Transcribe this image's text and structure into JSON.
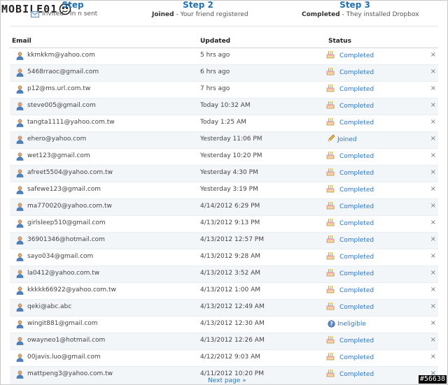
{
  "logo": {
    "text": "MOBILE01"
  },
  "steps": [
    {
      "title": "Step 1",
      "title_visible": "Step",
      "icon": "envelope-icon",
      "strong": "",
      "text": "Invited - Invitation sent",
      "text_visible": "Invited - In        n sent"
    },
    {
      "title": "Step 2",
      "icon": "pencil-icon",
      "strong": "Joined",
      "text": " - Your friend registered"
    },
    {
      "title": "Step 3",
      "icon": "cake-icon",
      "strong": "Completed",
      "text": " - They installed Dropbox"
    }
  ],
  "table": {
    "headers": {
      "email": "Email",
      "updated": "Updated",
      "status": "Status"
    },
    "rows": [
      {
        "email": "kkmkkm@yahoo.com",
        "updated": "5 hrs ago",
        "status": "Completed",
        "icon": "cake-icon"
      },
      {
        "email": "5468rraoc@gmail.com",
        "updated": "6 hrs ago",
        "status": "Completed",
        "icon": "cake-icon"
      },
      {
        "email": "p12@ms.url.com.tw",
        "updated": "7 hrs ago",
        "status": "Completed",
        "icon": "cake-icon"
      },
      {
        "email": "steve005@gmail.com",
        "updated": "Today 10:32 AM",
        "status": "Completed",
        "icon": "cake-icon"
      },
      {
        "email": "tangta1111@yahoo.com.tw",
        "updated": "Today 1:25 AM",
        "status": "Completed",
        "icon": "cake-icon"
      },
      {
        "email": "ehero@yahoo.com",
        "updated": "Yesterday 11:06 PM",
        "status": "Joined",
        "icon": "pencil-icon"
      },
      {
        "email": "wet123@gmail.com",
        "updated": "Yesterday 10:20 PM",
        "status": "Completed",
        "icon": "cake-icon"
      },
      {
        "email": "afreet5504@yahoo.com.tw",
        "updated": "Yesterday 4:30 PM",
        "status": "Completed",
        "icon": "cake-icon"
      },
      {
        "email": "safewe123@gmail.com",
        "updated": "Yesterday 3:19 PM",
        "status": "Completed",
        "icon": "cake-icon"
      },
      {
        "email": "ma770020@yahoo.com.tw",
        "updated": "4/14/2012 6:29 PM",
        "status": "Completed",
        "icon": "cake-icon"
      },
      {
        "email": "girlsleep510@gmail.com",
        "updated": "4/13/2012 9:13 PM",
        "status": "Completed",
        "icon": "cake-icon"
      },
      {
        "email": "36901346@hotmail.com",
        "updated": "4/13/2012 12:57 PM",
        "status": "Completed",
        "icon": "cake-icon"
      },
      {
        "email": "sayo034@gmail.com",
        "updated": "4/13/2012 9:28 AM",
        "status": "Completed",
        "icon": "cake-icon"
      },
      {
        "email": "la0412@yahoo.com.tw",
        "updated": "4/13/2012 3:52 AM",
        "status": "Completed",
        "icon": "cake-icon"
      },
      {
        "email": "kkkkk66922@yahoo.com.tw",
        "updated": "4/13/2012 1:00 AM",
        "status": "Completed",
        "icon": "cake-icon"
      },
      {
        "email": "qeki@abc.abc",
        "updated": "4/13/2012 12:49 AM",
        "status": "Completed",
        "icon": "cake-icon"
      },
      {
        "email": "wingit881@gmail.com",
        "updated": "4/13/2012 12:30 AM",
        "status": "Ineligible",
        "icon": "question-icon"
      },
      {
        "email": "owayneo1@hotmail.com",
        "updated": "4/13/2012 12:26 AM",
        "status": "Completed",
        "icon": "cake-icon"
      },
      {
        "email": "00javis.luo@gmail.com",
        "updated": "4/12/2012 9:03 AM",
        "status": "Completed",
        "icon": "cake-icon"
      },
      {
        "email": "mattpeng3@yahoo.com.tw",
        "updated": "4/11/2012 10:20 PM",
        "status": "Completed",
        "icon": "cake-icon"
      }
    ],
    "remove_glyph": "×"
  },
  "pager": {
    "next_label": "Next page »"
  },
  "watermark": "#56638",
  "colors": {
    "link": "#2a76c6",
    "step_title": "#1f6fb5",
    "row_alt": "#f2f6f9"
  }
}
